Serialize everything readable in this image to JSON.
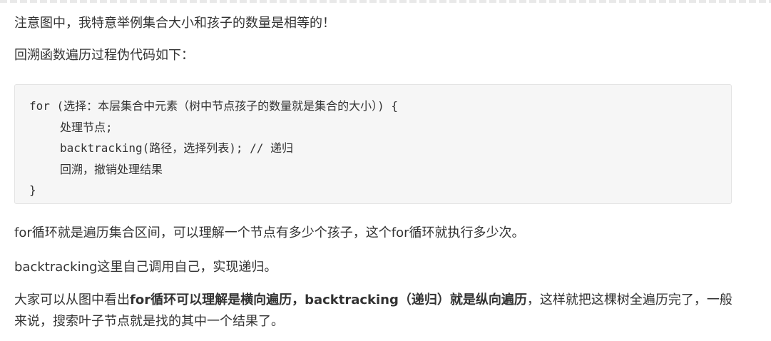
{
  "paragraphs": {
    "note": "注意图中，我特意举例集合大小和孩子的数量是相等的！",
    "intro": "回溯函数遍历过程伪代码如下："
  },
  "code": {
    "line1": "for (选择：本层集合中元素（树中节点孩子的数量就是集合的大小）) {",
    "line2": "处理节点;",
    "line3": "backtracking(路径，选择列表); // 递归",
    "line4": "回溯，撤销处理结果",
    "line5": "}"
  },
  "explanation": {
    "for_loop": "for循环就是遍历集合区间，可以理解一个节点有多少个孩子，这个for循环就执行多少次。",
    "recursion": "backtracking这里自己调用自己，实现递归。",
    "summary_prefix": "大家可以从图中看出",
    "summary_bold1": "for循环可以理解是横向遍历，backtracking（递归）就是纵向遍历",
    "summary_suffix": "，这样就把这棵树全遍历完了，一般来说，搜索叶子节点就是找的其中一个结果了。"
  }
}
